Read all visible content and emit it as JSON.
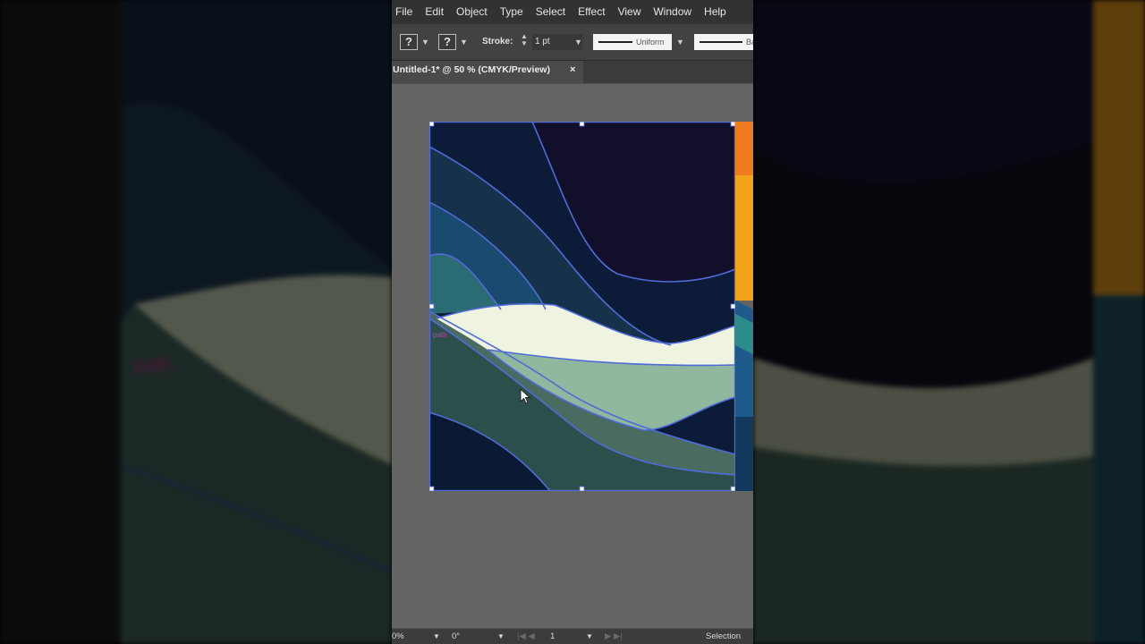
{
  "menu": [
    "File",
    "Edit",
    "Object",
    "Type",
    "Select",
    "Effect",
    "View",
    "Window",
    "Help"
  ],
  "control_bar": {
    "fill_glyph": "?",
    "stroke_glyph": "?",
    "stroke_label": "Stroke:",
    "stroke_weight": "1 pt",
    "profile_label": "Uniform",
    "brush_label": "Ba"
  },
  "document_tab": {
    "title": "Untitled-1* @ 50 % (CMYK/Preview)",
    "close_glyph": "×"
  },
  "artwork": {
    "colors": {
      "sky_top": "#120f2a",
      "band_navy": "#0c1c38",
      "band_teal_dark": "#15324a",
      "band_blue": "#1a4a6e",
      "band_teal": "#2b6c74",
      "wave_cream": "#eef4e0",
      "wave_sage": "#8fb89f",
      "band_forest": "#4a6b60",
      "band_pine": "#2d4f4b",
      "bottom_navy": "#0a1a35",
      "selection_outline": "#4f6bd8",
      "orange_strip": "#f07a1e",
      "gold_strip": "#f2a31a"
    },
    "path_hint": "path"
  },
  "status_bar": {
    "zoom": "0%",
    "rotation": "0°",
    "artboard_number": "1",
    "tool": "Selection"
  }
}
